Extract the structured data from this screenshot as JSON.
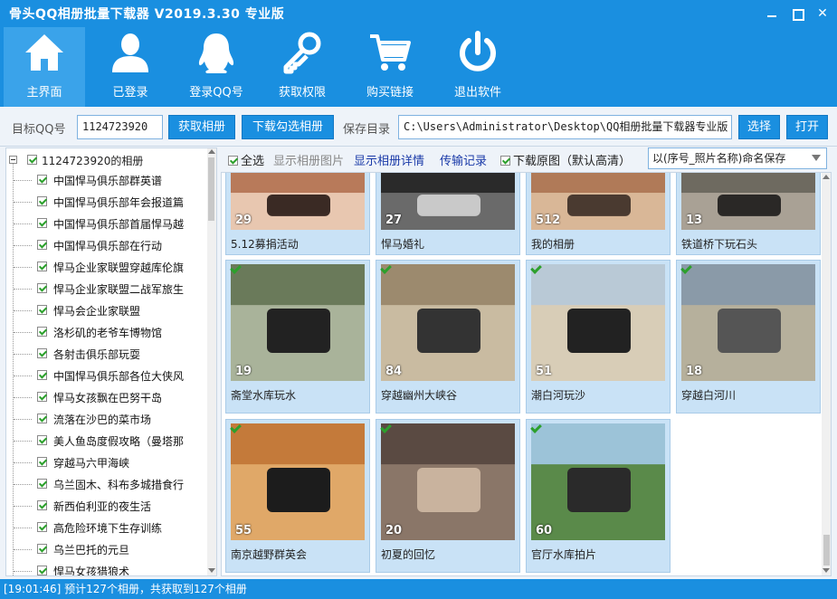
{
  "window": {
    "title": "骨头QQ相册批量下载器 V2019.3.30 专业版"
  },
  "toolbar": {
    "items": [
      {
        "label": "主界面",
        "icon": "home-icon",
        "active": true
      },
      {
        "label": "已登录",
        "icon": "user-icon"
      },
      {
        "label": "登录QQ号",
        "icon": "qq-penguin-icon"
      },
      {
        "label": "获取权限",
        "icon": "key-icon"
      },
      {
        "label": "购买链接",
        "icon": "cart-icon"
      },
      {
        "label": "退出软件",
        "icon": "power-icon"
      }
    ]
  },
  "addr": {
    "qq_label": "目标QQ号",
    "qq_value": "1124723920",
    "get_album_button": "获取相册",
    "download_checked_button": "下载勾选相册",
    "save_dir_label": "保存目录",
    "save_dir_value": "C:\\Users\\Administrator\\Desktop\\QQ相册批量下载器专业版",
    "choose_button": "选择",
    "open_button": "打开"
  },
  "tree": {
    "root": "1124723920的相册",
    "items": [
      "中国悍马俱乐部群英谱",
      "中国悍马俱乐部年会报道篇",
      "中国悍马俱乐部首届悍马越",
      "中国悍马俱乐部在行动",
      "悍马企业家联盟穿越库伦旗",
      "悍马企业家联盟二战军旅生",
      "悍马会企业家联盟",
      "洛杉矶的老爷车博物馆",
      "各射击俱乐部玩耍",
      "中国悍马俱乐部各位大侠风",
      "悍马女孩飘在巴努干岛",
      "流落在沙巴的菜市场",
      "美人鱼岛度假攻略（曼塔那",
      "穿越马六甲海峡",
      "乌兰固木、科布多城措食行",
      "新西伯利亚的夜生活",
      "高危险环境下生存训练",
      "乌兰巴托的元旦",
      "悍马女孩猎狼术"
    ]
  },
  "options": {
    "select_all": "全选",
    "show_pictures": "显示相册图片",
    "show_details": "显示相册详情",
    "transfer_log": "传输记录",
    "download_original": "下载原图（默认高清）",
    "naming_select": "以(序号_照片名称)命名保存"
  },
  "albums": [
    {
      "name": "5.12募捐活动",
      "count": "29"
    },
    {
      "name": "悍马婚礼",
      "count": "27"
    },
    {
      "name": "我的相册",
      "count": "512"
    },
    {
      "name": "铁道桥下玩石头",
      "count": "13"
    },
    {
      "name": "斋堂水库玩水",
      "count": "19"
    },
    {
      "name": "穿越幽州大峡谷",
      "count": "84"
    },
    {
      "name": "潮白河玩沙",
      "count": "51"
    },
    {
      "name": "穿越白河川",
      "count": "18"
    },
    {
      "name": "南京越野群英会",
      "count": "55"
    },
    {
      "name": "初夏的回忆",
      "count": "20"
    },
    {
      "name": "官厅水库拍片",
      "count": "60"
    }
  ],
  "status": {
    "text": "[19:01:46] 预计127个相册，共获取到127个相册"
  }
}
